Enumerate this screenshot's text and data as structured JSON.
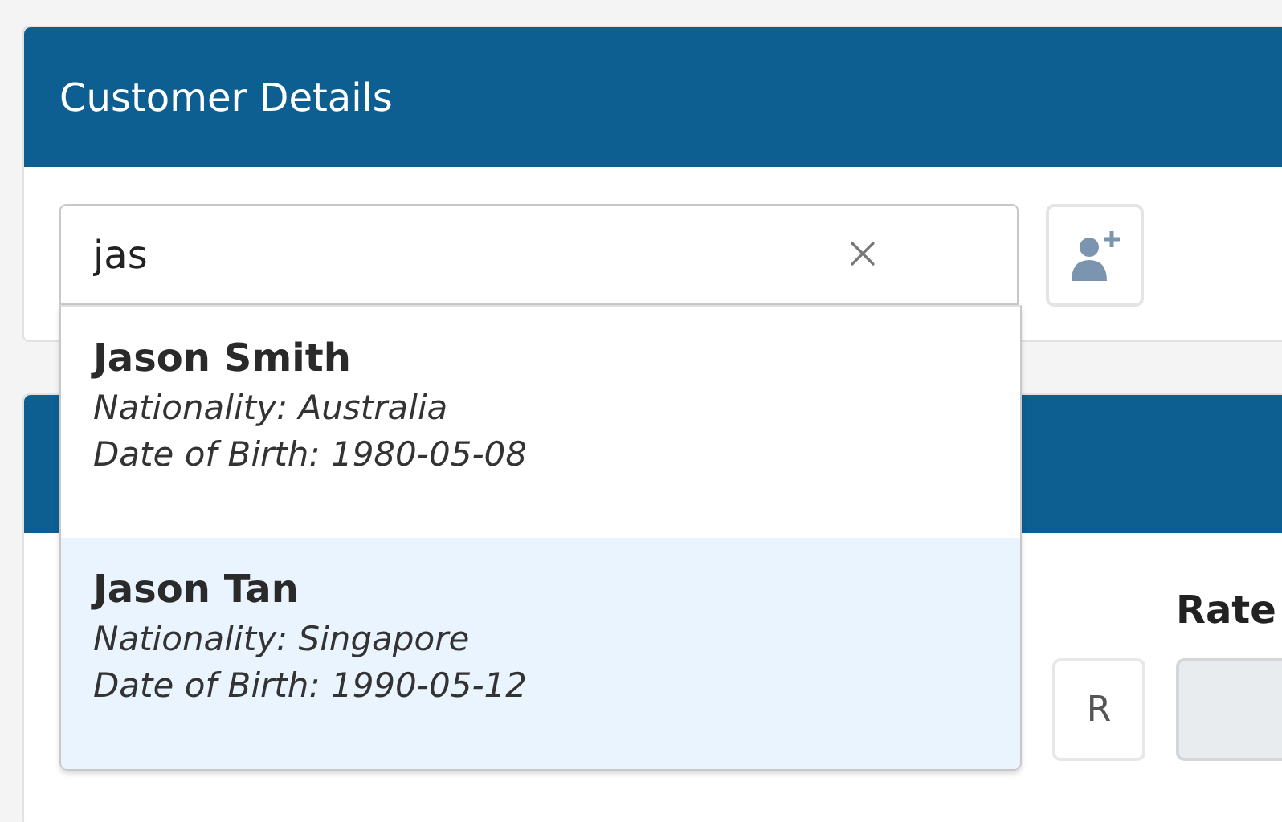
{
  "customer_panel": {
    "title": "Customer Details",
    "search": {
      "value": "jas"
    },
    "results": [
      {
        "name": "Jason Smith",
        "nationality": "Nationality: Australia",
        "birth": "Date of Birth: 1980-05-08",
        "selected": false
      },
      {
        "name": "Jason Tan",
        "nationality": "Nationality: Singapore",
        "birth": "Date of Birth: 1990-05-12",
        "selected": true
      }
    ]
  },
  "second_panel": {
    "addon": "R",
    "rate_label": "Rate"
  }
}
